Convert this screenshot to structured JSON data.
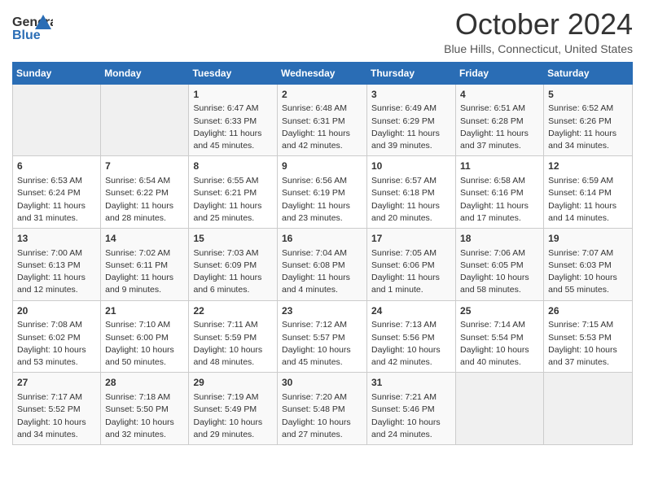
{
  "header": {
    "logo_line1": "General",
    "logo_line2": "Blue",
    "month": "October 2024",
    "location": "Blue Hills, Connecticut, United States"
  },
  "days_of_week": [
    "Sunday",
    "Monday",
    "Tuesday",
    "Wednesday",
    "Thursday",
    "Friday",
    "Saturday"
  ],
  "weeks": [
    [
      {
        "day": "",
        "info": ""
      },
      {
        "day": "",
        "info": ""
      },
      {
        "day": "1",
        "info": "Sunrise: 6:47 AM\nSunset: 6:33 PM\nDaylight: 11 hours and 45 minutes."
      },
      {
        "day": "2",
        "info": "Sunrise: 6:48 AM\nSunset: 6:31 PM\nDaylight: 11 hours and 42 minutes."
      },
      {
        "day": "3",
        "info": "Sunrise: 6:49 AM\nSunset: 6:29 PM\nDaylight: 11 hours and 39 minutes."
      },
      {
        "day": "4",
        "info": "Sunrise: 6:51 AM\nSunset: 6:28 PM\nDaylight: 11 hours and 37 minutes."
      },
      {
        "day": "5",
        "info": "Sunrise: 6:52 AM\nSunset: 6:26 PM\nDaylight: 11 hours and 34 minutes."
      }
    ],
    [
      {
        "day": "6",
        "info": "Sunrise: 6:53 AM\nSunset: 6:24 PM\nDaylight: 11 hours and 31 minutes."
      },
      {
        "day": "7",
        "info": "Sunrise: 6:54 AM\nSunset: 6:22 PM\nDaylight: 11 hours and 28 minutes."
      },
      {
        "day": "8",
        "info": "Sunrise: 6:55 AM\nSunset: 6:21 PM\nDaylight: 11 hours and 25 minutes."
      },
      {
        "day": "9",
        "info": "Sunrise: 6:56 AM\nSunset: 6:19 PM\nDaylight: 11 hours and 23 minutes."
      },
      {
        "day": "10",
        "info": "Sunrise: 6:57 AM\nSunset: 6:18 PM\nDaylight: 11 hours and 20 minutes."
      },
      {
        "day": "11",
        "info": "Sunrise: 6:58 AM\nSunset: 6:16 PM\nDaylight: 11 hours and 17 minutes."
      },
      {
        "day": "12",
        "info": "Sunrise: 6:59 AM\nSunset: 6:14 PM\nDaylight: 11 hours and 14 minutes."
      }
    ],
    [
      {
        "day": "13",
        "info": "Sunrise: 7:00 AM\nSunset: 6:13 PM\nDaylight: 11 hours and 12 minutes."
      },
      {
        "day": "14",
        "info": "Sunrise: 7:02 AM\nSunset: 6:11 PM\nDaylight: 11 hours and 9 minutes."
      },
      {
        "day": "15",
        "info": "Sunrise: 7:03 AM\nSunset: 6:09 PM\nDaylight: 11 hours and 6 minutes."
      },
      {
        "day": "16",
        "info": "Sunrise: 7:04 AM\nSunset: 6:08 PM\nDaylight: 11 hours and 4 minutes."
      },
      {
        "day": "17",
        "info": "Sunrise: 7:05 AM\nSunset: 6:06 PM\nDaylight: 11 hours and 1 minute."
      },
      {
        "day": "18",
        "info": "Sunrise: 7:06 AM\nSunset: 6:05 PM\nDaylight: 10 hours and 58 minutes."
      },
      {
        "day": "19",
        "info": "Sunrise: 7:07 AM\nSunset: 6:03 PM\nDaylight: 10 hours and 55 minutes."
      }
    ],
    [
      {
        "day": "20",
        "info": "Sunrise: 7:08 AM\nSunset: 6:02 PM\nDaylight: 10 hours and 53 minutes."
      },
      {
        "day": "21",
        "info": "Sunrise: 7:10 AM\nSunset: 6:00 PM\nDaylight: 10 hours and 50 minutes."
      },
      {
        "day": "22",
        "info": "Sunrise: 7:11 AM\nSunset: 5:59 PM\nDaylight: 10 hours and 48 minutes."
      },
      {
        "day": "23",
        "info": "Sunrise: 7:12 AM\nSunset: 5:57 PM\nDaylight: 10 hours and 45 minutes."
      },
      {
        "day": "24",
        "info": "Sunrise: 7:13 AM\nSunset: 5:56 PM\nDaylight: 10 hours and 42 minutes."
      },
      {
        "day": "25",
        "info": "Sunrise: 7:14 AM\nSunset: 5:54 PM\nDaylight: 10 hours and 40 minutes."
      },
      {
        "day": "26",
        "info": "Sunrise: 7:15 AM\nSunset: 5:53 PM\nDaylight: 10 hours and 37 minutes."
      }
    ],
    [
      {
        "day": "27",
        "info": "Sunrise: 7:17 AM\nSunset: 5:52 PM\nDaylight: 10 hours and 34 minutes."
      },
      {
        "day": "28",
        "info": "Sunrise: 7:18 AM\nSunset: 5:50 PM\nDaylight: 10 hours and 32 minutes."
      },
      {
        "day": "29",
        "info": "Sunrise: 7:19 AM\nSunset: 5:49 PM\nDaylight: 10 hours and 29 minutes."
      },
      {
        "day": "30",
        "info": "Sunrise: 7:20 AM\nSunset: 5:48 PM\nDaylight: 10 hours and 27 minutes."
      },
      {
        "day": "31",
        "info": "Sunrise: 7:21 AM\nSunset: 5:46 PM\nDaylight: 10 hours and 24 minutes."
      },
      {
        "day": "",
        "info": ""
      },
      {
        "day": "",
        "info": ""
      }
    ]
  ]
}
